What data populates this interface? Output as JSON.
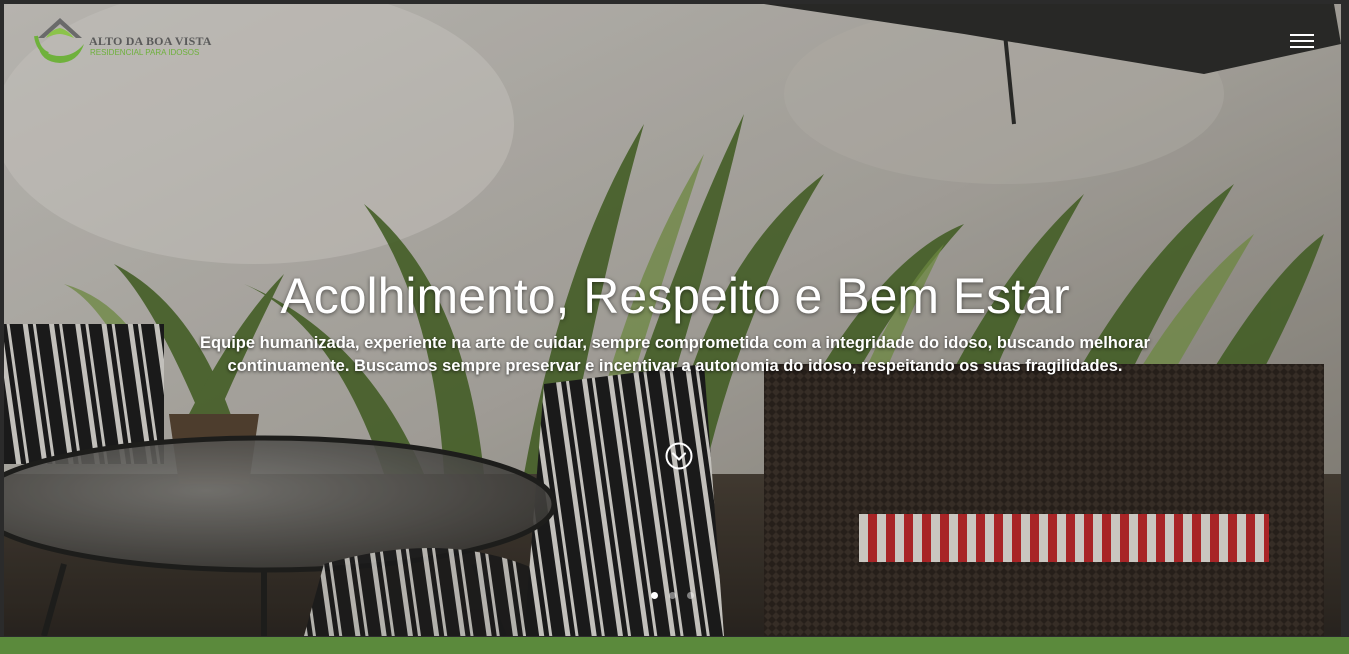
{
  "logo": {
    "title": "ALTO DA BOA VISTA",
    "subtitle": "RESIDENCIAL PARA IDOSOS"
  },
  "nav": {
    "menu_icon": "hamburger-menu-icon"
  },
  "hero": {
    "headline": "Acolhimento, Respeito e Bem Estar",
    "description": "Equipe humanizada, experiente na arte de cuidar, sempre comprometida com a integridade do idoso, buscando melhorar continuamente. Buscamos sempre preservar e incentivar a autonomia do idoso, respeitando os suas fragilidades.",
    "scroll_icon": "chevron-down-circle-icon"
  },
  "carousel": {
    "slide_count": 3,
    "active_slide": 1
  },
  "colors": {
    "accent_green": "#5b8a3c",
    "logo_green": "#6fb13c",
    "logo_gray": "#5a5a5a",
    "text": "#ffffff"
  }
}
